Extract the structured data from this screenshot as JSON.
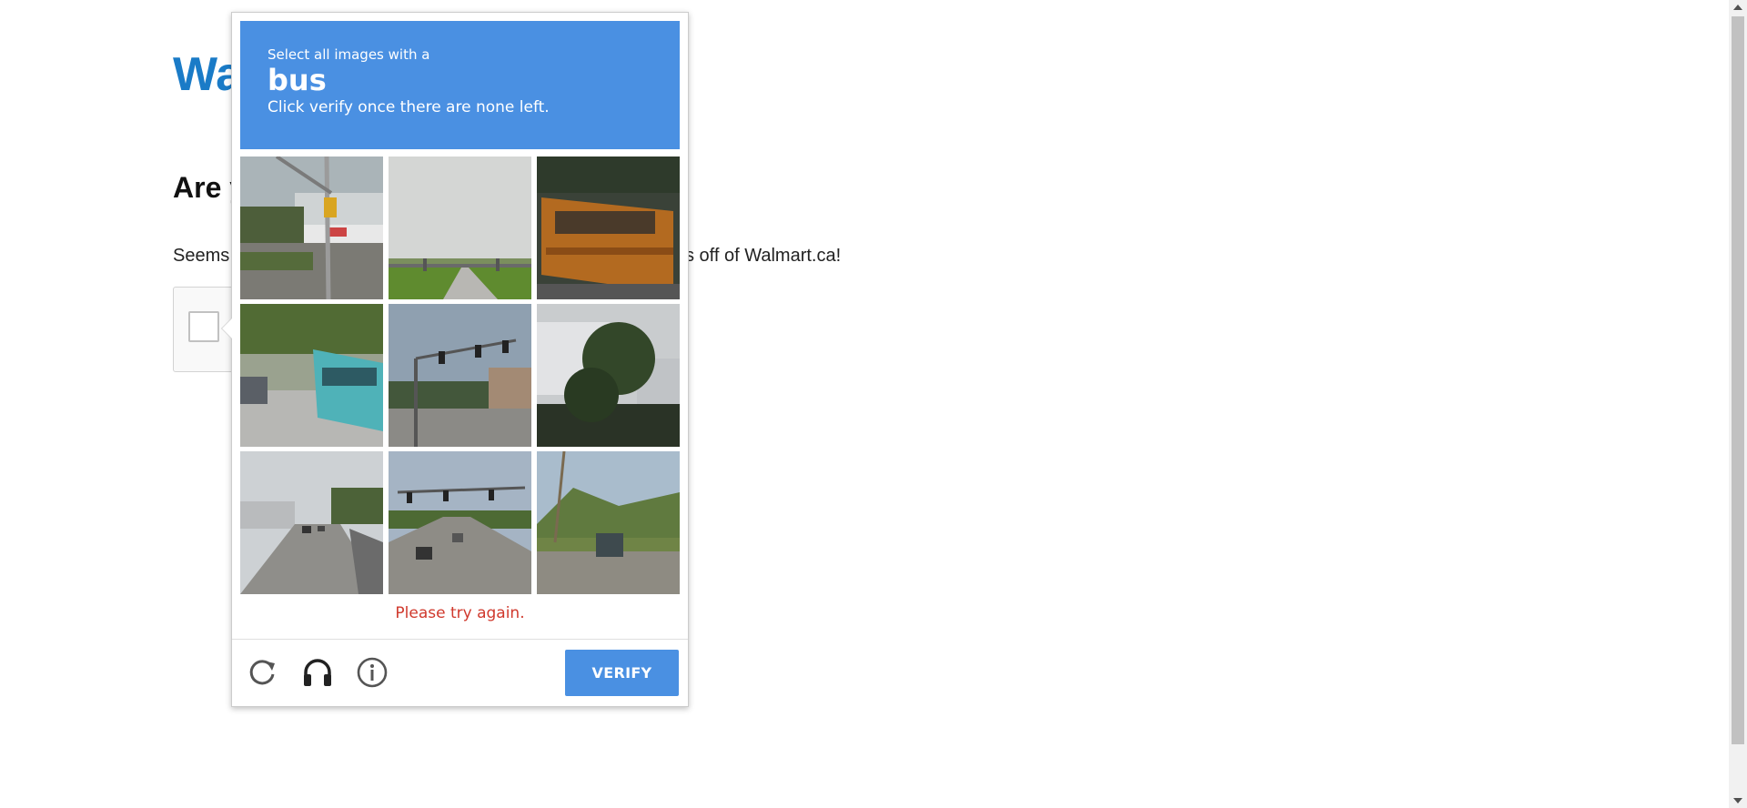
{
  "page": {
    "brand": "Wa",
    "heading": "Are y",
    "body_start": "Seems",
    "body_end": "s off of Walmart.ca!"
  },
  "challenge": {
    "instruction_small": "Select all images with a",
    "target": "bus",
    "instruction_sub": "Click verify once there are none left.",
    "error_text": "Please try again.",
    "verify_label": "VERIFY",
    "header_color": "#4a90e2",
    "tiles": [
      {
        "name": "tile-traffic-light-parking-lot"
      },
      {
        "name": "tile-overpass-road"
      },
      {
        "name": "tile-orange-bus"
      },
      {
        "name": "tile-teal-bus"
      },
      {
        "name": "tile-traffic-lights-intersection"
      },
      {
        "name": "tile-trees-house"
      },
      {
        "name": "tile-street-cars"
      },
      {
        "name": "tile-highway-traffic-lights"
      },
      {
        "name": "tile-road-hills-car"
      }
    ],
    "icons": [
      "reload-icon",
      "headphones-icon",
      "info-icon"
    ]
  }
}
